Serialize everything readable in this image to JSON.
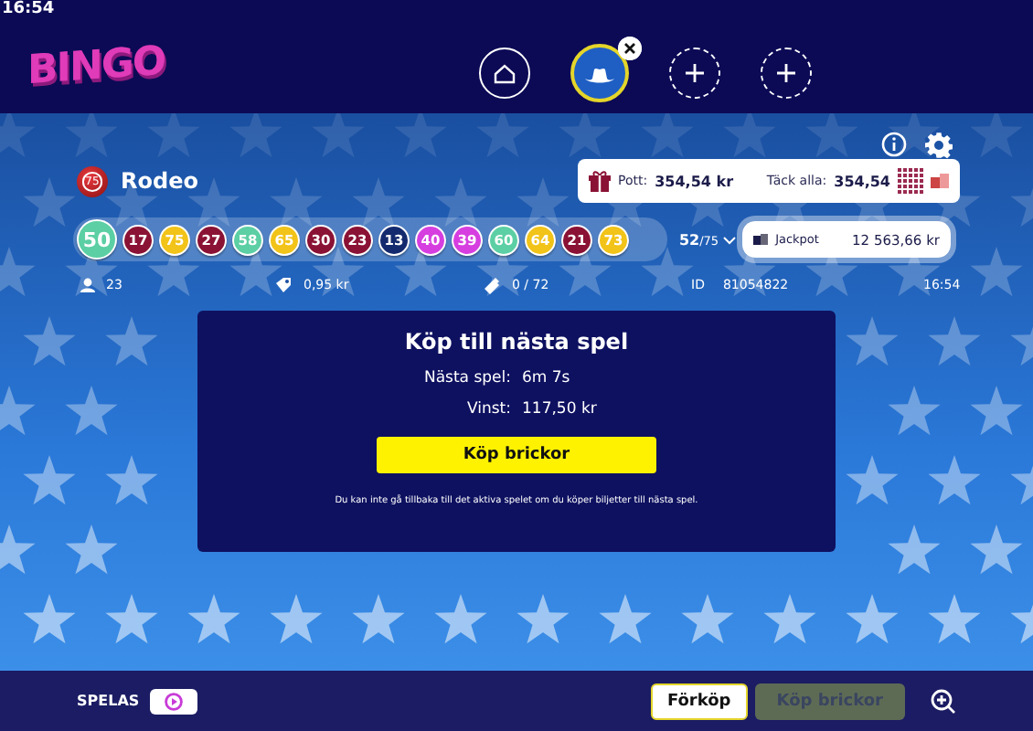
{
  "status_time": "16:54",
  "logo": "BINGO",
  "tabs": [
    {
      "kind": "home",
      "selected": false
    },
    {
      "kind": "game",
      "selected": true
    },
    {
      "kind": "add",
      "selected": false
    },
    {
      "kind": "add",
      "selected": false
    }
  ],
  "game": {
    "ball_count": "75",
    "name": "Rodeo"
  },
  "pot": {
    "label": "Pott:",
    "value": "354,54 kr",
    "cover_label": "Täck alla:",
    "cover_value": "354,54"
  },
  "balls": [
    {
      "number": "50",
      "color": "#5ccfa4"
    },
    {
      "number": "17",
      "color": "#8a1235"
    },
    {
      "number": "75",
      "color": "#f2c318"
    },
    {
      "number": "27",
      "color": "#8a1235"
    },
    {
      "number": "58",
      "color": "#5ccfa4"
    },
    {
      "number": "65",
      "color": "#f2c318"
    },
    {
      "number": "30",
      "color": "#8a1235"
    },
    {
      "number": "23",
      "color": "#8a1235"
    },
    {
      "number": "13",
      "color": "#142a6e"
    },
    {
      "number": "40",
      "color": "#d63ee0"
    },
    {
      "number": "39",
      "color": "#d63ee0"
    },
    {
      "number": "60",
      "color": "#5ccfa4"
    },
    {
      "number": "64",
      "color": "#f2c318"
    },
    {
      "number": "21",
      "color": "#8a1235"
    },
    {
      "number": "73",
      "color": "#f2c318"
    }
  ],
  "drawn": {
    "count": "52",
    "total": "/75"
  },
  "jackpot": {
    "label": "Jackpot",
    "value": "12 563,66 kr"
  },
  "stats": {
    "players": "23",
    "price": "0,95 kr",
    "tickets": "0 / 72",
    "id_label": "ID",
    "id": "81054822",
    "time": "16:54"
  },
  "panel": {
    "title": "Köp till nästa spel",
    "rows": [
      {
        "label": "Nästa spel:",
        "value": "6m 7s"
      },
      {
        "label": "Vinst:",
        "value": "117,50 kr"
      }
    ],
    "button": "Köp brickor",
    "note": "Du kan inte gå tillbaka till det aktiva spelet om du köper biljetter till nästa spel."
  },
  "bottom": {
    "playing_label": "SPELAS",
    "buttons": [
      {
        "label": "Förköp",
        "disabled": false
      },
      {
        "label": "Köp brickor",
        "disabled": true
      }
    ]
  }
}
